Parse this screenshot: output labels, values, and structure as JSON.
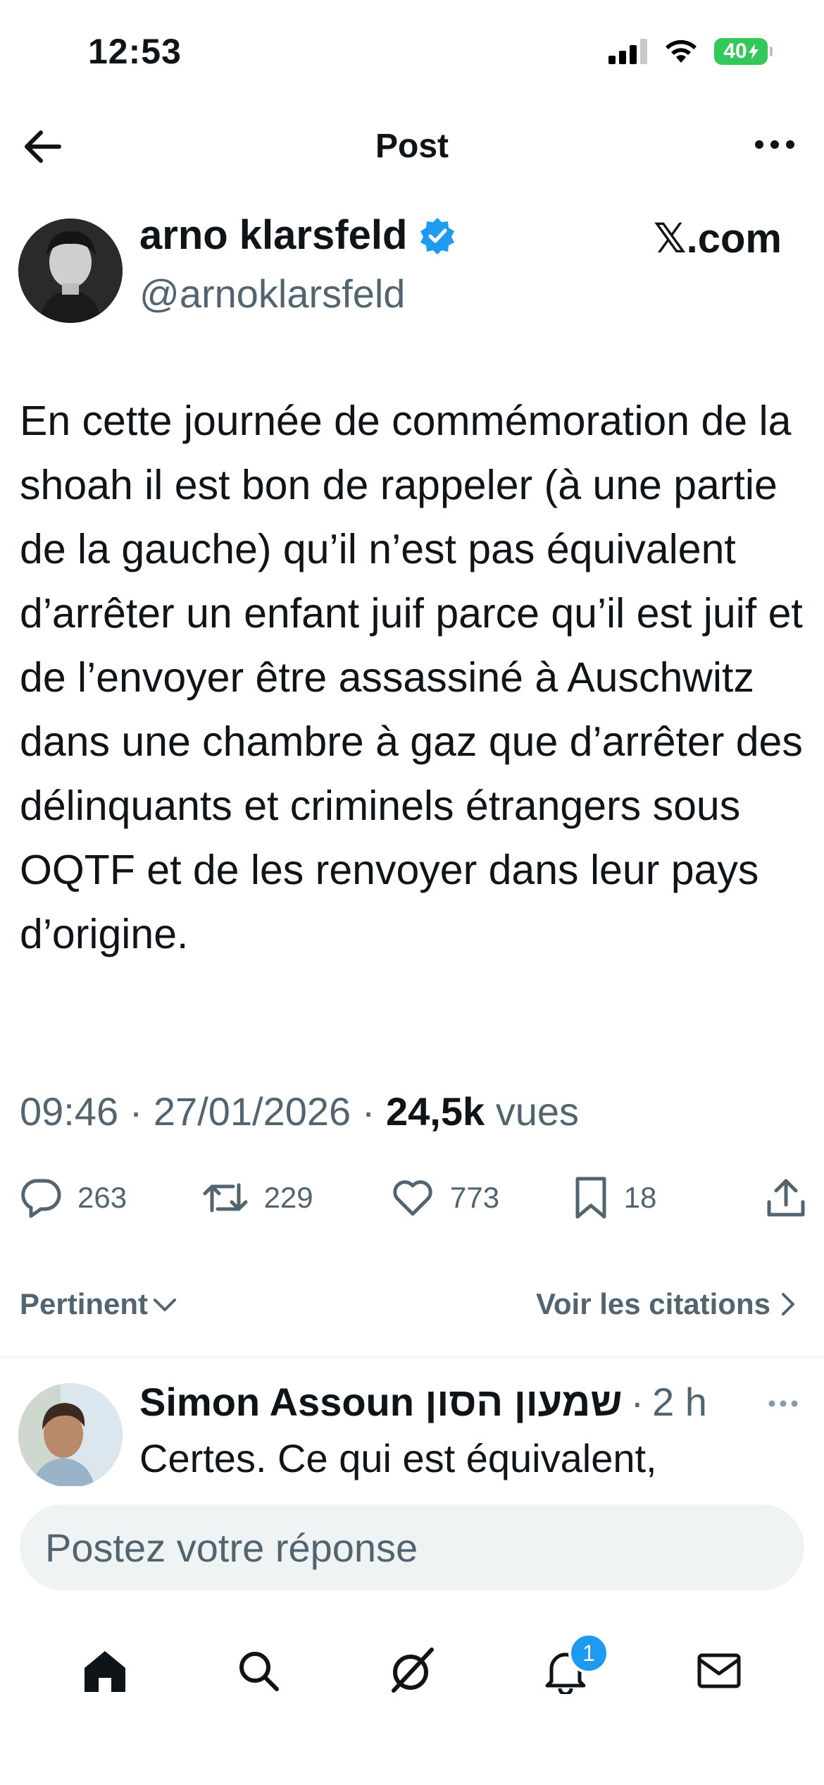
{
  "status_bar": {
    "time": "12:53",
    "battery": "40"
  },
  "header": {
    "title": "Post"
  },
  "post": {
    "author_name": "arno klarsfeld",
    "handle": "@arnoklarsfeld",
    "source_label": "𝕏.com",
    "text": "En cette journée de commémoration de la shoah il est bon de rappeler (à une partie de la gauche) qu’il n’est pas équivalent d’arrêter un enfant juif parce qu’il est juif et de l’envoyer être assassiné à Auschwitz dans une chambre à gaz que d’arrêter des délinquants et criminels étrangers sous OQTF et de les renvoyer dans leur pays d’origine.",
    "time": "09:46",
    "date": "27/01/2026",
    "views_count": "24,5k",
    "views_label": "vues",
    "stats": {
      "replies": "263",
      "reposts": "229",
      "likes": "773",
      "bookmarks": "18"
    }
  },
  "replies_bar": {
    "sort_label": "Pertinent",
    "quotes_label": "Voir les citations"
  },
  "reply": {
    "author_name": "Simon Assoun שמעון הסון",
    "time": "2 h",
    "text": "Certes. Ce qui est équivalent,"
  },
  "composer": {
    "placeholder": "Postez votre réponse"
  },
  "tabbar": {
    "notifications_badge": "1"
  },
  "colors": {
    "accent": "#1d9bf0",
    "secondary_text": "#536471",
    "battery": "#34c759"
  }
}
